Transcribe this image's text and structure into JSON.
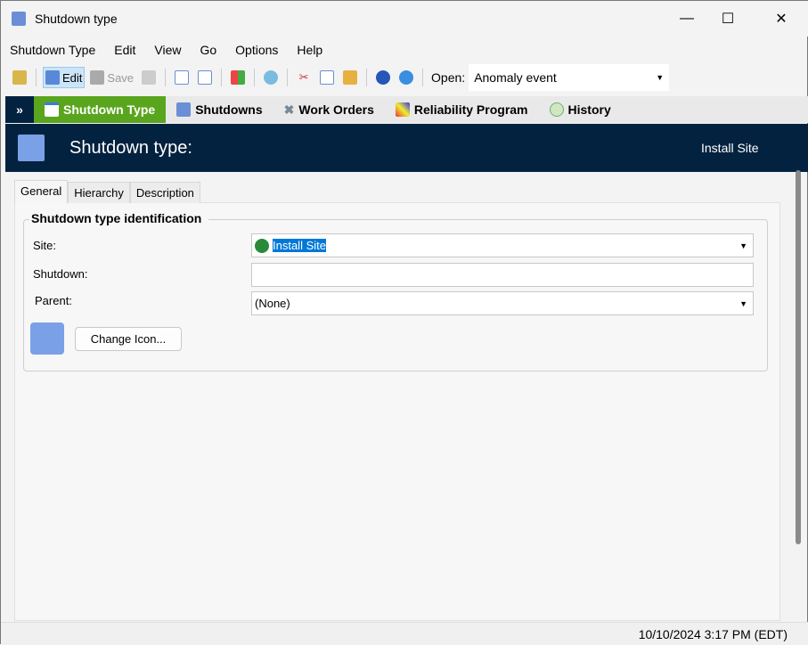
{
  "window": {
    "title": "Shutdown type"
  },
  "menu": [
    "Shutdown Type",
    "Edit",
    "View",
    "Go",
    "Options",
    "Help"
  ],
  "toolbar": {
    "edit": "Edit",
    "save": "Save",
    "open_label": "Open:",
    "open_value": "Anomaly event"
  },
  "nav": [
    "Shutdown Type",
    "Shutdowns",
    "Work Orders",
    "Reliability Program",
    "History"
  ],
  "header": {
    "title": "Shutdown type:",
    "site": "Install Site"
  },
  "tabs": [
    "General",
    "Hierarchy",
    "Description"
  ],
  "form": {
    "group_title": "Shutdown type identification",
    "site_label": "Site:",
    "site_value": "Install Site",
    "shutdown_label": "Shutdown:",
    "shutdown_value": "",
    "parent_label": "Parent:",
    "parent_value": "(None)",
    "change_icon": "Change Icon..."
  },
  "status": {
    "datetime": "10/10/2024 3:17 PM (EDT)"
  }
}
